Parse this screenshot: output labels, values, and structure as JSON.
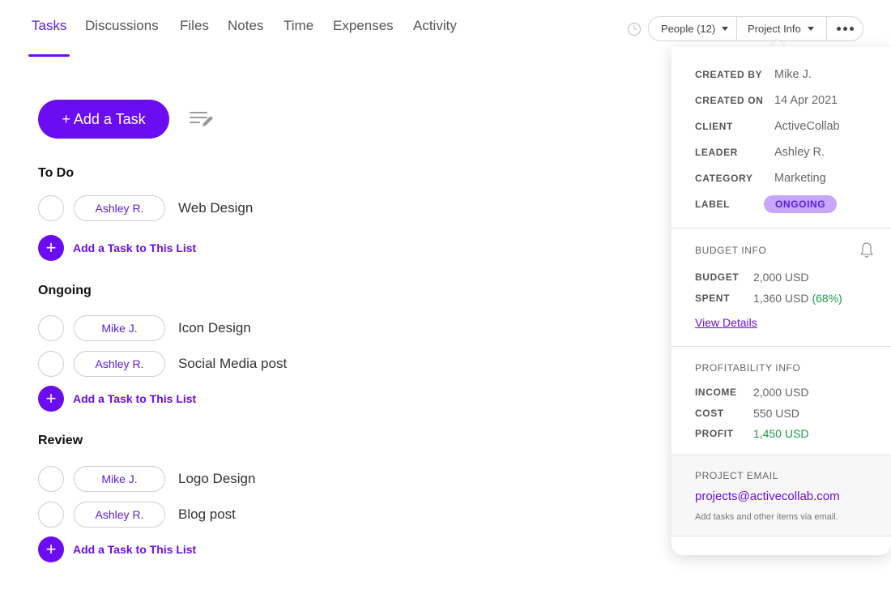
{
  "tabs": [
    {
      "label": "Tasks",
      "active": true
    },
    {
      "label": "Discussions"
    },
    {
      "label": "Files"
    },
    {
      "label": "Notes"
    },
    {
      "label": "Time"
    },
    {
      "label": "Expenses"
    },
    {
      "label": "Activity"
    }
  ],
  "toolbar": {
    "people_label": "People (12)",
    "project_info_label": "Project Info",
    "clock_icon": "clock-icon",
    "more_icon": "more-dots-icon"
  },
  "add_task_label": "+ Add a Task",
  "add_to_list_label": "Add a Task to This List",
  "lists": [
    {
      "title": "To Do",
      "tasks": [
        {
          "assignee": "Ashley R.",
          "name": "Web Design"
        }
      ]
    },
    {
      "title": "Ongoing",
      "tasks": [
        {
          "assignee": "Mike J.",
          "name": "Icon Design"
        },
        {
          "assignee": "Ashley R.",
          "name": "Social Media post"
        }
      ]
    },
    {
      "title": "Review",
      "tasks": [
        {
          "assignee": "Mike J.",
          "name": "Logo Design"
        },
        {
          "assignee": "Ashley R.",
          "name": "Blog post"
        }
      ]
    }
  ],
  "project_info": {
    "details": [
      {
        "key": "CREATED BY",
        "value": "Mike J."
      },
      {
        "key": "CREATED ON",
        "value": "14 Apr 2021"
      },
      {
        "key": "CLIENT",
        "value": "ActiveCollab"
      },
      {
        "key": "LEADER",
        "value": "Ashley R."
      },
      {
        "key": "CATEGORY",
        "value": "Marketing"
      }
    ],
    "label_key": "LABEL",
    "label_value": "ONGOING",
    "budget": {
      "heading": "BUDGET INFO",
      "budget_key": "BUDGET",
      "budget_value": "2,000 USD",
      "spent_key": "SPENT",
      "spent_value": "1,360 USD",
      "spent_percent": "(68%)",
      "view_details": "View Details"
    },
    "profitability": {
      "heading": "PROFITABILITY INFO",
      "income_key": "INCOME",
      "income_value": "2,000 USD",
      "cost_key": "COST",
      "cost_value": "550 USD",
      "profit_key": "PROFIT",
      "profit_value": "1,450 USD"
    },
    "email": {
      "heading": "PROJECT EMAIL",
      "address": "projects@activecollab.com",
      "note": "Add tasks and other items via email."
    }
  },
  "colors": {
    "accent": "#6b0df2",
    "label_badge_bg": "#c7a6fb",
    "positive": "#1a9a4a"
  }
}
